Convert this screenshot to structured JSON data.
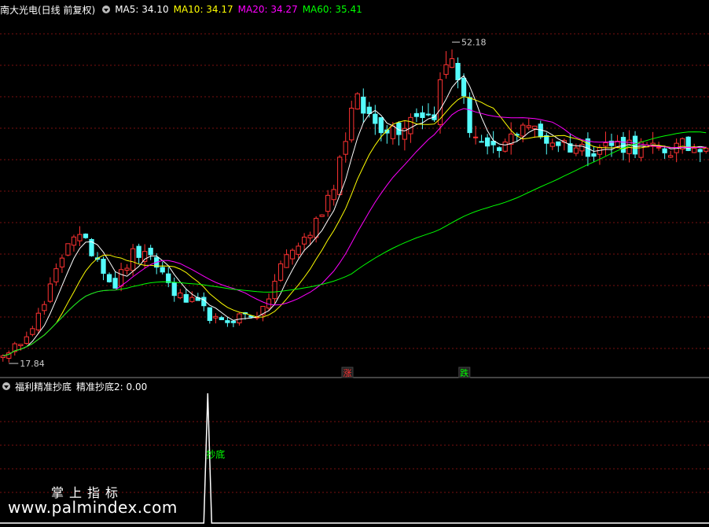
{
  "header": {
    "stock": "南大光电(日线 前复权)",
    "ma": [
      {
        "label": "MA5: 34.10",
        "color": "#ffffff"
      },
      {
        "label": "MA10: 34.17",
        "color": "#ffff00"
      },
      {
        "label": "MA20: 34.27",
        "color": "#ff00ff"
      },
      {
        "label": "MA60: 35.41",
        "color": "#00ff00"
      }
    ]
  },
  "sub_header": {
    "indicator": "福利精准抄底",
    "value_label": "精准抄底2: 0.00"
  },
  "watermark": {
    "line1": "掌上指标",
    "line2": "www.palmindex.com"
  },
  "colors": {
    "up": "#ff3232",
    "down": "#54fcfc",
    "ma5": "#ffffff",
    "ma10": "#ffff00",
    "ma20": "#ff00ff",
    "ma60": "#00ff00",
    "grid": "#7a1010",
    "signal_text": "#00ff00"
  },
  "chart_data": [
    {
      "type": "candlestick",
      "title": "",
      "ylim": [
        16.5,
        55
      ],
      "annotations": {
        "high": {
          "value": 52.18,
          "label": "52.18"
        },
        "low": {
          "value": 17.84,
          "label": "17.84"
        },
        "markers": [
          {
            "label": "涨",
            "color": "#ff3232",
            "position": 0.49
          },
          {
            "label": "跌",
            "color": "#00ff00",
            "position": 0.655
          }
        ]
      },
      "series": [
        {
          "name": "MA5",
          "color": "#ffffff"
        },
        {
          "name": "MA10",
          "color": "#ffff00"
        },
        {
          "name": "MA20",
          "color": "#ff00ff"
        },
        {
          "name": "MA60",
          "color": "#00ff00"
        }
      ]
    },
    {
      "type": "line",
      "title": "",
      "series": [
        {
          "name": "精准抄底2",
          "last": 0.0
        }
      ],
      "signal": {
        "label": "抄底",
        "position": 0.293,
        "value": 1
      }
    }
  ]
}
